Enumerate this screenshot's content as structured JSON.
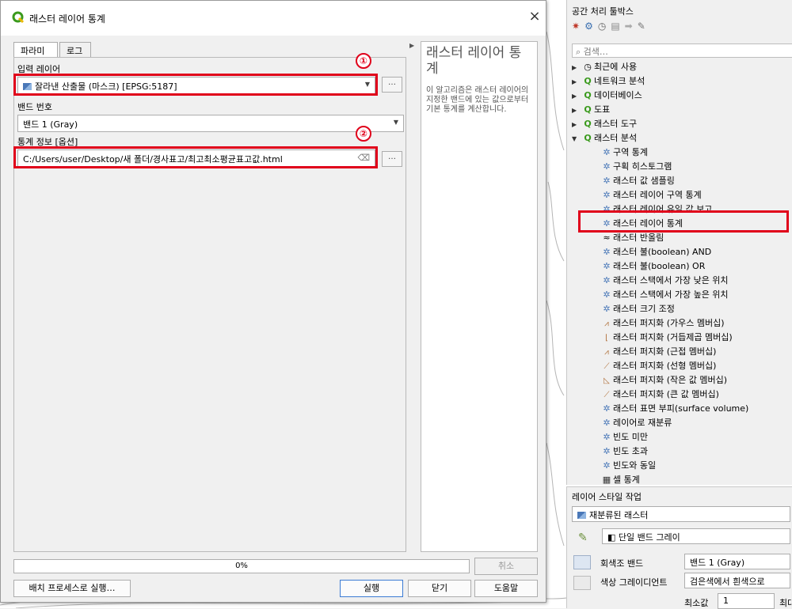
{
  "dialog": {
    "title": "래스터 레이어 통계",
    "close": "×",
    "tabs": [
      "파라미터",
      "로그"
    ],
    "input_layer_label": "입력 레이어",
    "input_layer_value": "잘라낸 산출물 (마스크) [EPSG:5187]",
    "band_label": "밴드 번호",
    "band_value": "밴드 1 (Gray)",
    "stats_label": "통계 정보 [옵션]",
    "stats_value": "C:/Users/user/Desktop/새 폴더/경사표고/최고최소평균표고값.html",
    "dots": "…",
    "clear_icon": "⌫",
    "circle1": "①",
    "circle2": "②",
    "help_title": "래스터 레이어 통계",
    "help_body": "이 알고리즘은 래스터 레이어의 지정한 밴드에 있는 값으로부터 기본 통계를 계산합니다.",
    "progress_text": "0%",
    "progress": 0,
    "cancel": "취소",
    "batch": "배치 프로세스로 실행…",
    "run": "실행",
    "close_btn": "닫기",
    "help": "도움말"
  },
  "toolbox": {
    "title": "공간 처리 툴박스",
    "search_placeholder": "검색…",
    "groups": [
      {
        "label": "최근에 사용",
        "icon": "clock-icon"
      },
      {
        "label": "네트워크 분석",
        "icon": "qgis-icon"
      },
      {
        "label": "데이터베이스",
        "icon": "qgis-icon"
      },
      {
        "label": "도표",
        "icon": "qgis-icon"
      },
      {
        "label": "래스터 도구",
        "icon": "qgis-icon"
      },
      {
        "label": "래스터 분석",
        "icon": "qgis-icon"
      }
    ],
    "items": [
      "구역 통계",
      "구획 히스토그램",
      "래스터 값 샘플링",
      "래스터 레이어 구역 통계",
      "래스터 레이어 유일 값 보고",
      "래스터 레이어 통계",
      "래스터 반올림",
      "래스터 불(boolean) AND",
      "래스터 불(boolean) OR",
      "래스터 스택에서 가장 낮은 위치",
      "래스터 스택에서 가장 높은 위치",
      "래스터 크기 조정",
      "래스터 퍼지화 (가우스 멤버십)",
      "래스터 퍼지화 (거듭제곱 멤버십)",
      "래스터 퍼지화 (근접 멤버십)",
      "래스터 퍼지화 (선형 멤버십)",
      "래스터 퍼지화 (작은 값 멤버십)",
      "래스터 퍼지화 (큰 값 멤버십)",
      "래스터 표면 부피(surface volume)",
      "레이어로 재분류",
      "빈도 미만",
      "빈도 초과",
      "빈도와 동일",
      "셀 통계"
    ]
  },
  "style": {
    "title": "레이어 스타일 작업",
    "layer": "재분류된 래스터",
    "renderer": "단일 밴드 그레이",
    "gray_band_label": "회색조 밴드",
    "gray_band_value": "밴드 1 (Gray)",
    "gradient_label": "색상 그레이디언트",
    "gradient_value": "검은색에서 흰색으로",
    "min_label": "최소값",
    "min_value": "1",
    "max_label_partial": "최대"
  },
  "colors": {
    "highlight": "#e0001a",
    "qgis_green": "#3a9a1c"
  }
}
